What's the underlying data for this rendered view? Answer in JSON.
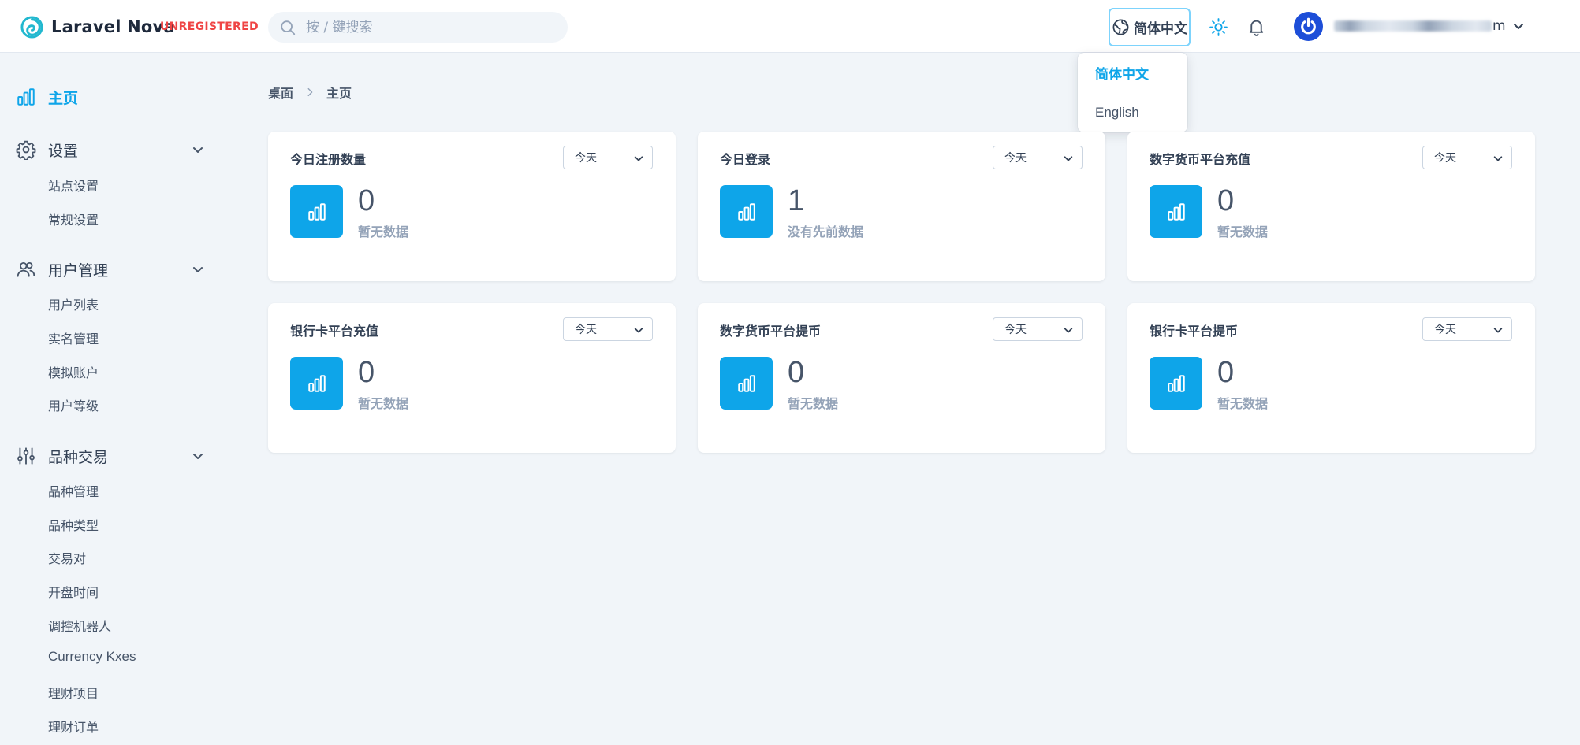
{
  "header": {
    "logo_text": "Laravel Nova",
    "badge": "UNREGISTERED",
    "search_placeholder": "按 / 键搜索",
    "language_button": "简体中文",
    "user_name_tail": "m"
  },
  "language_dropdown": {
    "options": [
      "简体中文",
      "English"
    ],
    "selected": "简体中文"
  },
  "sidebar": {
    "home": "主页",
    "sections": [
      {
        "label": "设置",
        "items": [
          "站点设置",
          "常规设置"
        ]
      },
      {
        "label": "用户管理",
        "items": [
          "用户列表",
          "实名管理",
          "模拟账户",
          "用户等级"
        ]
      },
      {
        "label": "品种交易",
        "items": [
          "品种管理",
          "品种类型",
          "交易对",
          "开盘时间",
          "调控机器人",
          "Currency Kxes",
          "理财项目",
          "理财订单"
        ]
      }
    ]
  },
  "breadcrumb": [
    "桌面",
    "主页"
  ],
  "cards": [
    {
      "title": "今日注册数量",
      "range": "今天",
      "value": "0",
      "note": "暂无数据"
    },
    {
      "title": "今日登录",
      "range": "今天",
      "value": "1",
      "note": "没有先前数据"
    },
    {
      "title": "数字货币平台充值",
      "range": "今天",
      "value": "0",
      "note": "暂无数据"
    },
    {
      "title": "银行卡平台充值",
      "range": "今天",
      "value": "0",
      "note": "暂无数据"
    },
    {
      "title": "数字货币平台提币",
      "range": "今天",
      "value": "0",
      "note": "暂无数据"
    },
    {
      "title": "银行卡平台提币",
      "range": "今天",
      "value": "0",
      "note": "暂无数据"
    }
  ],
  "colors": {
    "accent": "#0ea5e9",
    "danger": "#ef4444",
    "background": "#f1f5f9",
    "text": "#334155"
  }
}
